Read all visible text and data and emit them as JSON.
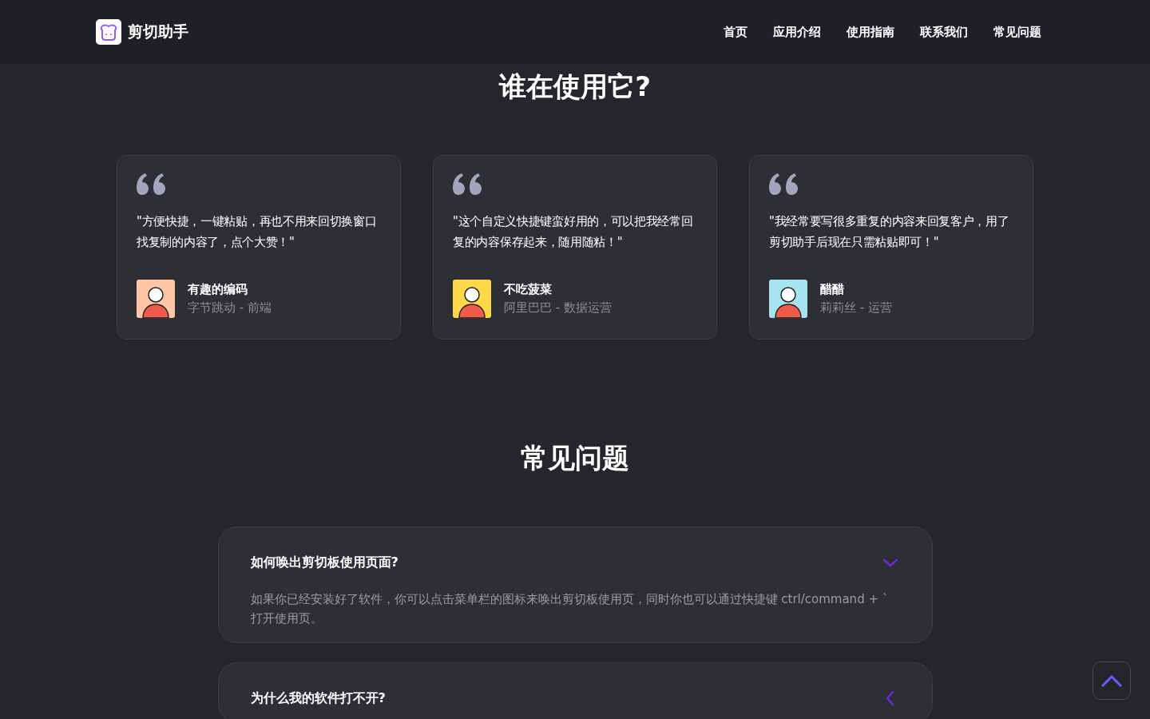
{
  "header": {
    "brand": "剪切助手",
    "nav": [
      "首页",
      "应用介绍",
      "使用指南",
      "联系我们",
      "常见问题"
    ]
  },
  "testimonials": {
    "title": "谁在使用它?",
    "items": [
      {
        "quote": "\"方便快捷，一键粘贴，再也不用来回切换窗口找复制的内容了，点个大赞！\"",
        "name": "有趣的编码",
        "role": "字节跳动 - 前端",
        "color": "#ffc7a6"
      },
      {
        "quote": "\"这个自定义快捷键蛮好用的，可以把我经常回复的内容保存起来，随用随粘！\"",
        "name": "不吃菠菜",
        "role": "阿里巴巴 - 数据运营",
        "color": "#ffd84a"
      },
      {
        "quote": "\"我经常要写很多重复的内容来回复客户，用了剪切助手后现在只需粘贴即可！\"",
        "name": "醋醋",
        "role": "莉莉丝 - 运营",
        "color": "#a6e4f2"
      }
    ]
  },
  "faq": {
    "title": "常见问题",
    "items": [
      {
        "question": "如何唤出剪切板使用页面?",
        "answer": "如果你已经安装好了软件，你可以点击菜单栏的图标来唤出剪切板使用页，同时你也可以通过快捷键 ctrl/command + ` 打开使用页。",
        "expanded": true
      },
      {
        "question": "为什么我的软件打不开?",
        "expanded": false
      }
    ]
  }
}
